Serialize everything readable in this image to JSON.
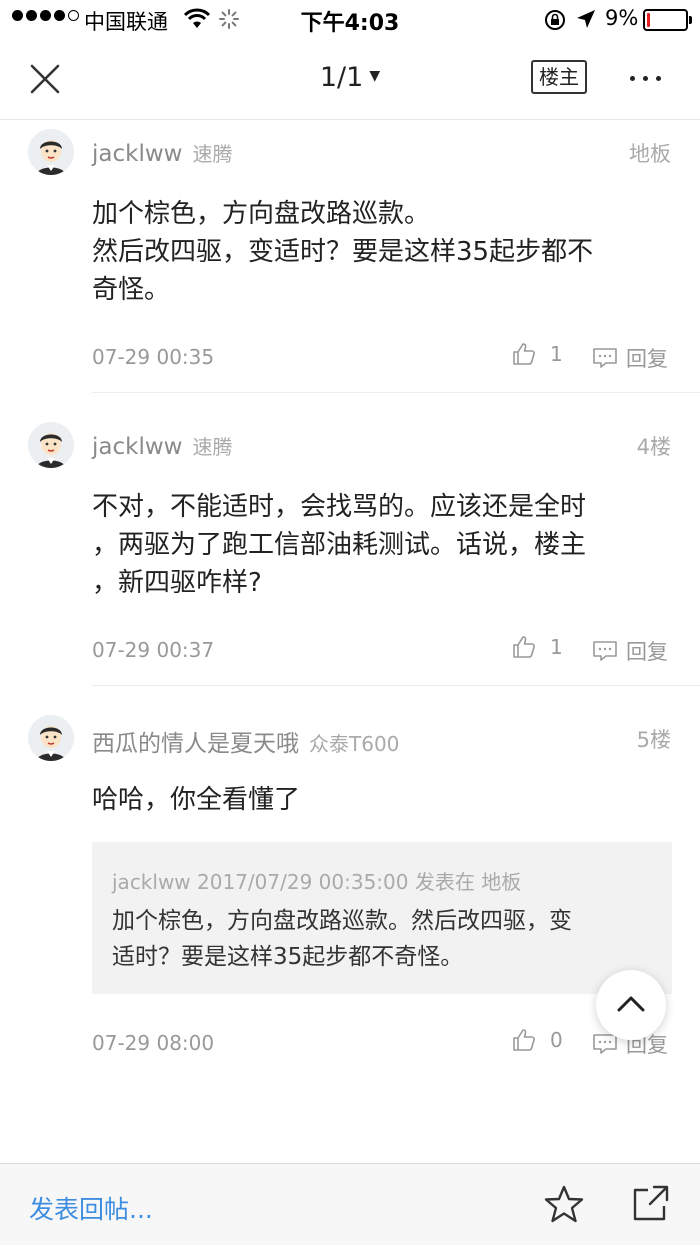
{
  "status_bar": {
    "carrier": "中国联通",
    "time": "下午4:03",
    "battery_pct": "9%",
    "battery_level": 0.09,
    "battery_color": "#e8201f"
  },
  "nav": {
    "pager": "1/1",
    "owner_label": "楼主",
    "icons": [
      "close-icon",
      "caret-down-icon",
      "more-icon"
    ]
  },
  "posts": [
    {
      "author": "jacklww",
      "device": "速腾",
      "floor": "地板",
      "content": [
        "加个棕色，方向盘改路巡款。",
        "然后改四驱，变适时？要是这样35起步都不",
        "奇怪。"
      ],
      "time": "07-29 00:35",
      "likes": "1",
      "reply_label": "回复"
    },
    {
      "author": "jacklww",
      "device": "速腾",
      "floor": "4楼",
      "content": [
        "不对，不能适时，会找骂的。应该还是全时",
        "，两驱为了跑工信部油耗测试。话说，楼主",
        "，新四驱咋样?"
      ],
      "time": "07-29 00:37",
      "likes": "1",
      "reply_label": "回复"
    },
    {
      "author": "西瓜的情人是夏天哦",
      "device": "众泰T600",
      "floor": "5楼",
      "content": [
        "哈哈，你全看懂了"
      ],
      "quote_head": "jacklww 2017/07/29 00:35:00 发表在 地板",
      "quote_text": [
        "加个棕色，方向盘改路巡款。然后改四驱，变",
        "适时？要是这样35起步都不奇怪。"
      ],
      "time": "07-29 08:00",
      "likes": "0",
      "reply_label": "回复"
    }
  ],
  "bottom": {
    "compose_label": "发表回帖...",
    "accent": "#3d8ee0"
  }
}
